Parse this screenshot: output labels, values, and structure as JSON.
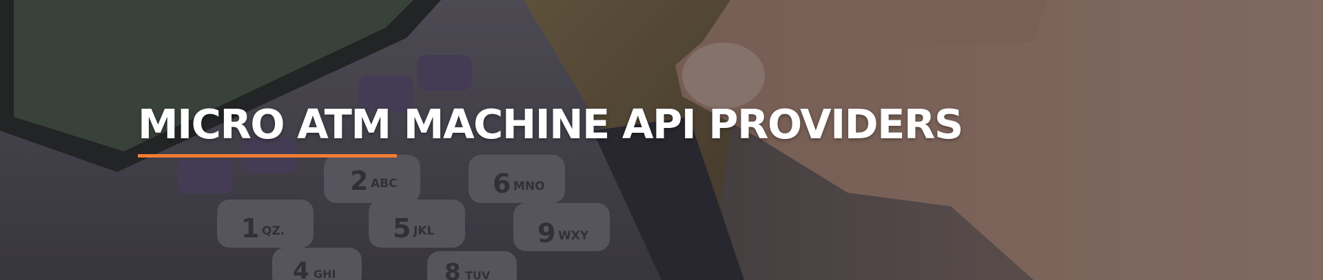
{
  "banner": {
    "title": "MICRO ATM MACHINE API PROVIDERS",
    "accent_color": "#f07c33",
    "background_image": "hand-inserting-card-into-pos-terminal"
  },
  "keypad": {
    "keys": [
      {
        "digit": "1",
        "letters": "QZ."
      },
      {
        "digit": "2",
        "letters": "ABC"
      },
      {
        "digit": "4",
        "letters": "GHI"
      },
      {
        "digit": "5",
        "letters": "JKL"
      },
      {
        "digit": "6",
        "letters": "MNO"
      },
      {
        "digit": "8",
        "letters": "TUV"
      },
      {
        "digit": "9",
        "letters": "WXY"
      }
    ]
  }
}
